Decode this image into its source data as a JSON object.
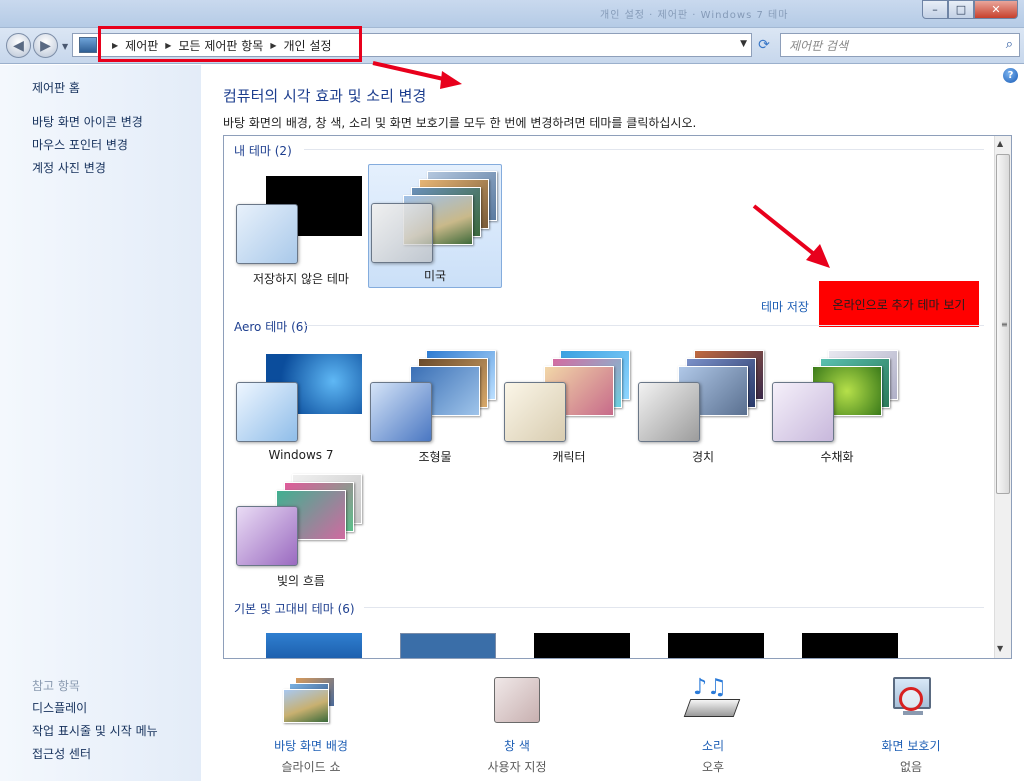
{
  "window": {
    "blurred_title": "개인 설정 · 제어판 · Windows 7 테마",
    "min": "–",
    "max": "□",
    "close": "✕"
  },
  "nav": {
    "back": "◀",
    "forward": "▶"
  },
  "address": {
    "crumbs": [
      "제어판",
      "모든 제어판 항목",
      "개인 설정"
    ],
    "sep": "▶"
  },
  "search": {
    "placeholder": "제어판 검색"
  },
  "sidebar": {
    "home": "제어판 홈",
    "links": [
      "바탕 화면 아이콘 변경",
      "마우스 포인터 변경",
      "계정 사진 변경"
    ],
    "see_also": "참고 항목",
    "see_also_links": [
      "디스플레이",
      "작업 표시줄 및 시작 메뉴",
      "접근성 센터"
    ]
  },
  "main": {
    "help": "?",
    "heading": "컴퓨터의 시각 효과 및 소리 변경",
    "description": "바탕 화면의 배경, 창 색, 소리 및 화면 보호기를 모두 한 번에 변경하려면 테마를 클릭하십시오.",
    "my_themes_header": "내 테마 (2)",
    "my_themes": [
      "저장하지 않은 테마",
      "미국"
    ],
    "save_theme": "테마 저장",
    "online_themes": "온라인으로 추가 테마 보기",
    "aero_header": "Aero 테마 (6)",
    "aero_themes": [
      "Windows 7",
      "조형물",
      "캐릭터",
      "경치",
      "수채화",
      "빛의 흐름"
    ],
    "basic_header": "기본 및 고대비 테마 (6)"
  },
  "bottom": [
    {
      "name": "바탕 화면 배경",
      "sub": "슬라이드 쇼"
    },
    {
      "name": "창 색",
      "sub": "사용자 지정"
    },
    {
      "name": "소리",
      "sub": "오후"
    },
    {
      "name": "화면 보호기",
      "sub": "없음"
    }
  ],
  "colors": {
    "accent": "#1e5fb5",
    "annotation_red": "#e8001c"
  }
}
